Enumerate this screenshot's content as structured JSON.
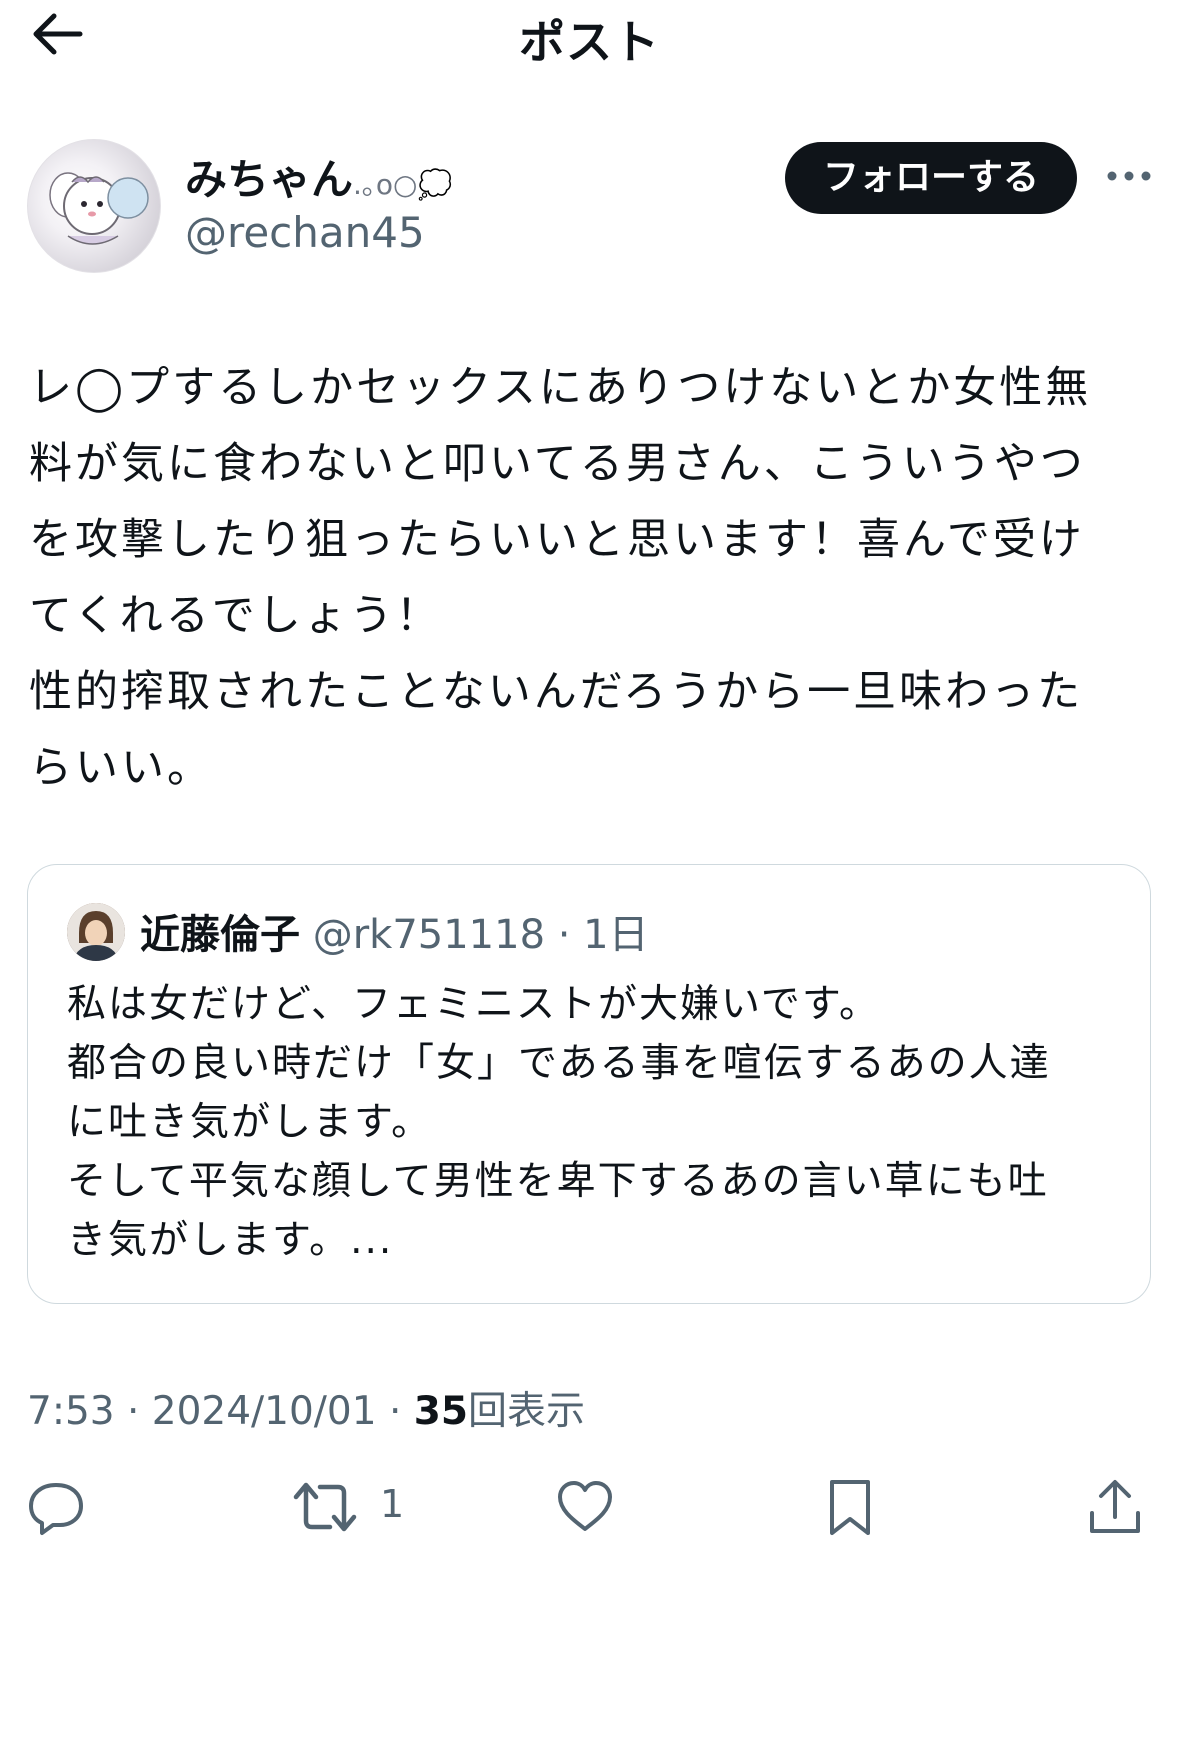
{
  "header": {
    "title": "ポスト",
    "back_icon": "arrow-left-icon"
  },
  "post": {
    "author": {
      "name": "みちゃん",
      "name_decoration": ".｡o○💭",
      "handle": "@rechan45"
    },
    "follow_label": "フォローする",
    "more_icon": "more-horizontal-icon",
    "text": "レ◯プするしかセックスにありつけないとか女性無\n料が気に食わないと叩いてる男さん、こういうやつ\nを攻撃したり狙ったらいいと思います！喜んで受け\nてくれるでしょう！\n性的搾取されたことないんだろうから一旦味わった\nらいい。",
    "quoted": {
      "name": "近藤倫子",
      "handle": "@rk751118",
      "time": "· 1日",
      "text": "私は女だけど、フェミニストが大嫌いです。\n都合の良い時だけ「女」である事を喧伝するあの人達\nに吐き気がします。\nそして平気な顔して男性を卑下するあの言い草にも吐\nき気がします。..."
    },
    "timestamp": "7:53 · 2024/10/01 · ",
    "views_count": "35",
    "views_label": "回表示"
  },
  "actions": {
    "reply_icon": "reply-icon",
    "retweet_icon": "retweet-icon",
    "retweet_count": "1",
    "like_icon": "heart-icon",
    "bookmark_icon": "bookmark-icon",
    "share_icon": "share-icon"
  },
  "colors": {
    "text": "#0f1419",
    "secondary": "#536471",
    "border": "#cfd9de",
    "button_bg": "#0f1419"
  }
}
